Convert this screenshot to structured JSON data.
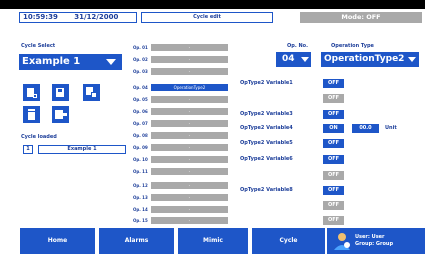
{
  "header": {
    "time": "10:59:39",
    "date": "31/12/2000",
    "status": "Cycle edit",
    "mode": "Mode: OFF"
  },
  "left": {
    "cycle_select_label": "Cycle Select",
    "cycle_value": "Example 1",
    "cycle_loaded_label": "Cycle loaded",
    "loaded_number": "1",
    "loaded_name": "Example 1"
  },
  "steps": [
    {
      "label": "Op. 01",
      "value": "-"
    },
    {
      "label": "Op. 02",
      "value": "-"
    },
    {
      "label": "Op. 03",
      "value": "-"
    },
    {
      "label": "Op. 04",
      "value": "OperationType2",
      "active": true
    },
    {
      "label": "Op. 05",
      "value": "-"
    },
    {
      "label": "Op. 06",
      "value": "-"
    },
    {
      "label": "Op. 07",
      "value": "-"
    },
    {
      "label": "Op. 08",
      "value": "-"
    },
    {
      "label": "Op. 09",
      "value": "-"
    },
    {
      "label": "Op. 10",
      "value": "-"
    },
    {
      "label": "Op. 11",
      "value": "-"
    },
    {
      "label": "Op. 12",
      "value": "-"
    },
    {
      "label": "Op. 13",
      "value": "-"
    },
    {
      "label": "Op. 14",
      "value": "-"
    },
    {
      "label": "Op. 15",
      "value": "-"
    }
  ],
  "right": {
    "op_no_label": "Op. No.",
    "op_no_value": "04",
    "op_type_label": "Operation Type",
    "op_type_value": "OperationType2",
    "variables": [
      {
        "label": "OpType2 Variable1",
        "state": "OFF",
        "style": "blue"
      },
      {
        "label": "",
        "state": "OFF",
        "style": "gray"
      },
      {
        "label": "OpType2 Variable3",
        "state": "OFF",
        "style": "blue"
      },
      {
        "label": "OpType2 Variable4",
        "state": "ON",
        "style": "on"
      },
      {
        "label": "OpType2 Variable5",
        "state": "OFF",
        "style": "blue"
      },
      {
        "label": "OpType2 Variable6",
        "state": "OFF",
        "style": "blue"
      },
      {
        "label": "",
        "state": "OFF",
        "style": "gray"
      },
      {
        "label": "OpType2 Variable8",
        "state": "OFF",
        "style": "blue"
      },
      {
        "label": "",
        "state": "OFF",
        "style": "gray"
      },
      {
        "label": "",
        "state": "OFF",
        "style": "gray"
      }
    ],
    "var4_value": "00.0",
    "var4_unit": "Unit"
  },
  "nav": {
    "home": "Home",
    "alarms": "Alarms",
    "mimic": "Mimic",
    "cycle": "Cycle",
    "user": "User: User",
    "group": "Group: Group"
  },
  "colors": {
    "accent": "#1e56c8",
    "disabled": "#a9a9a9",
    "text": "#1e3f9a"
  }
}
